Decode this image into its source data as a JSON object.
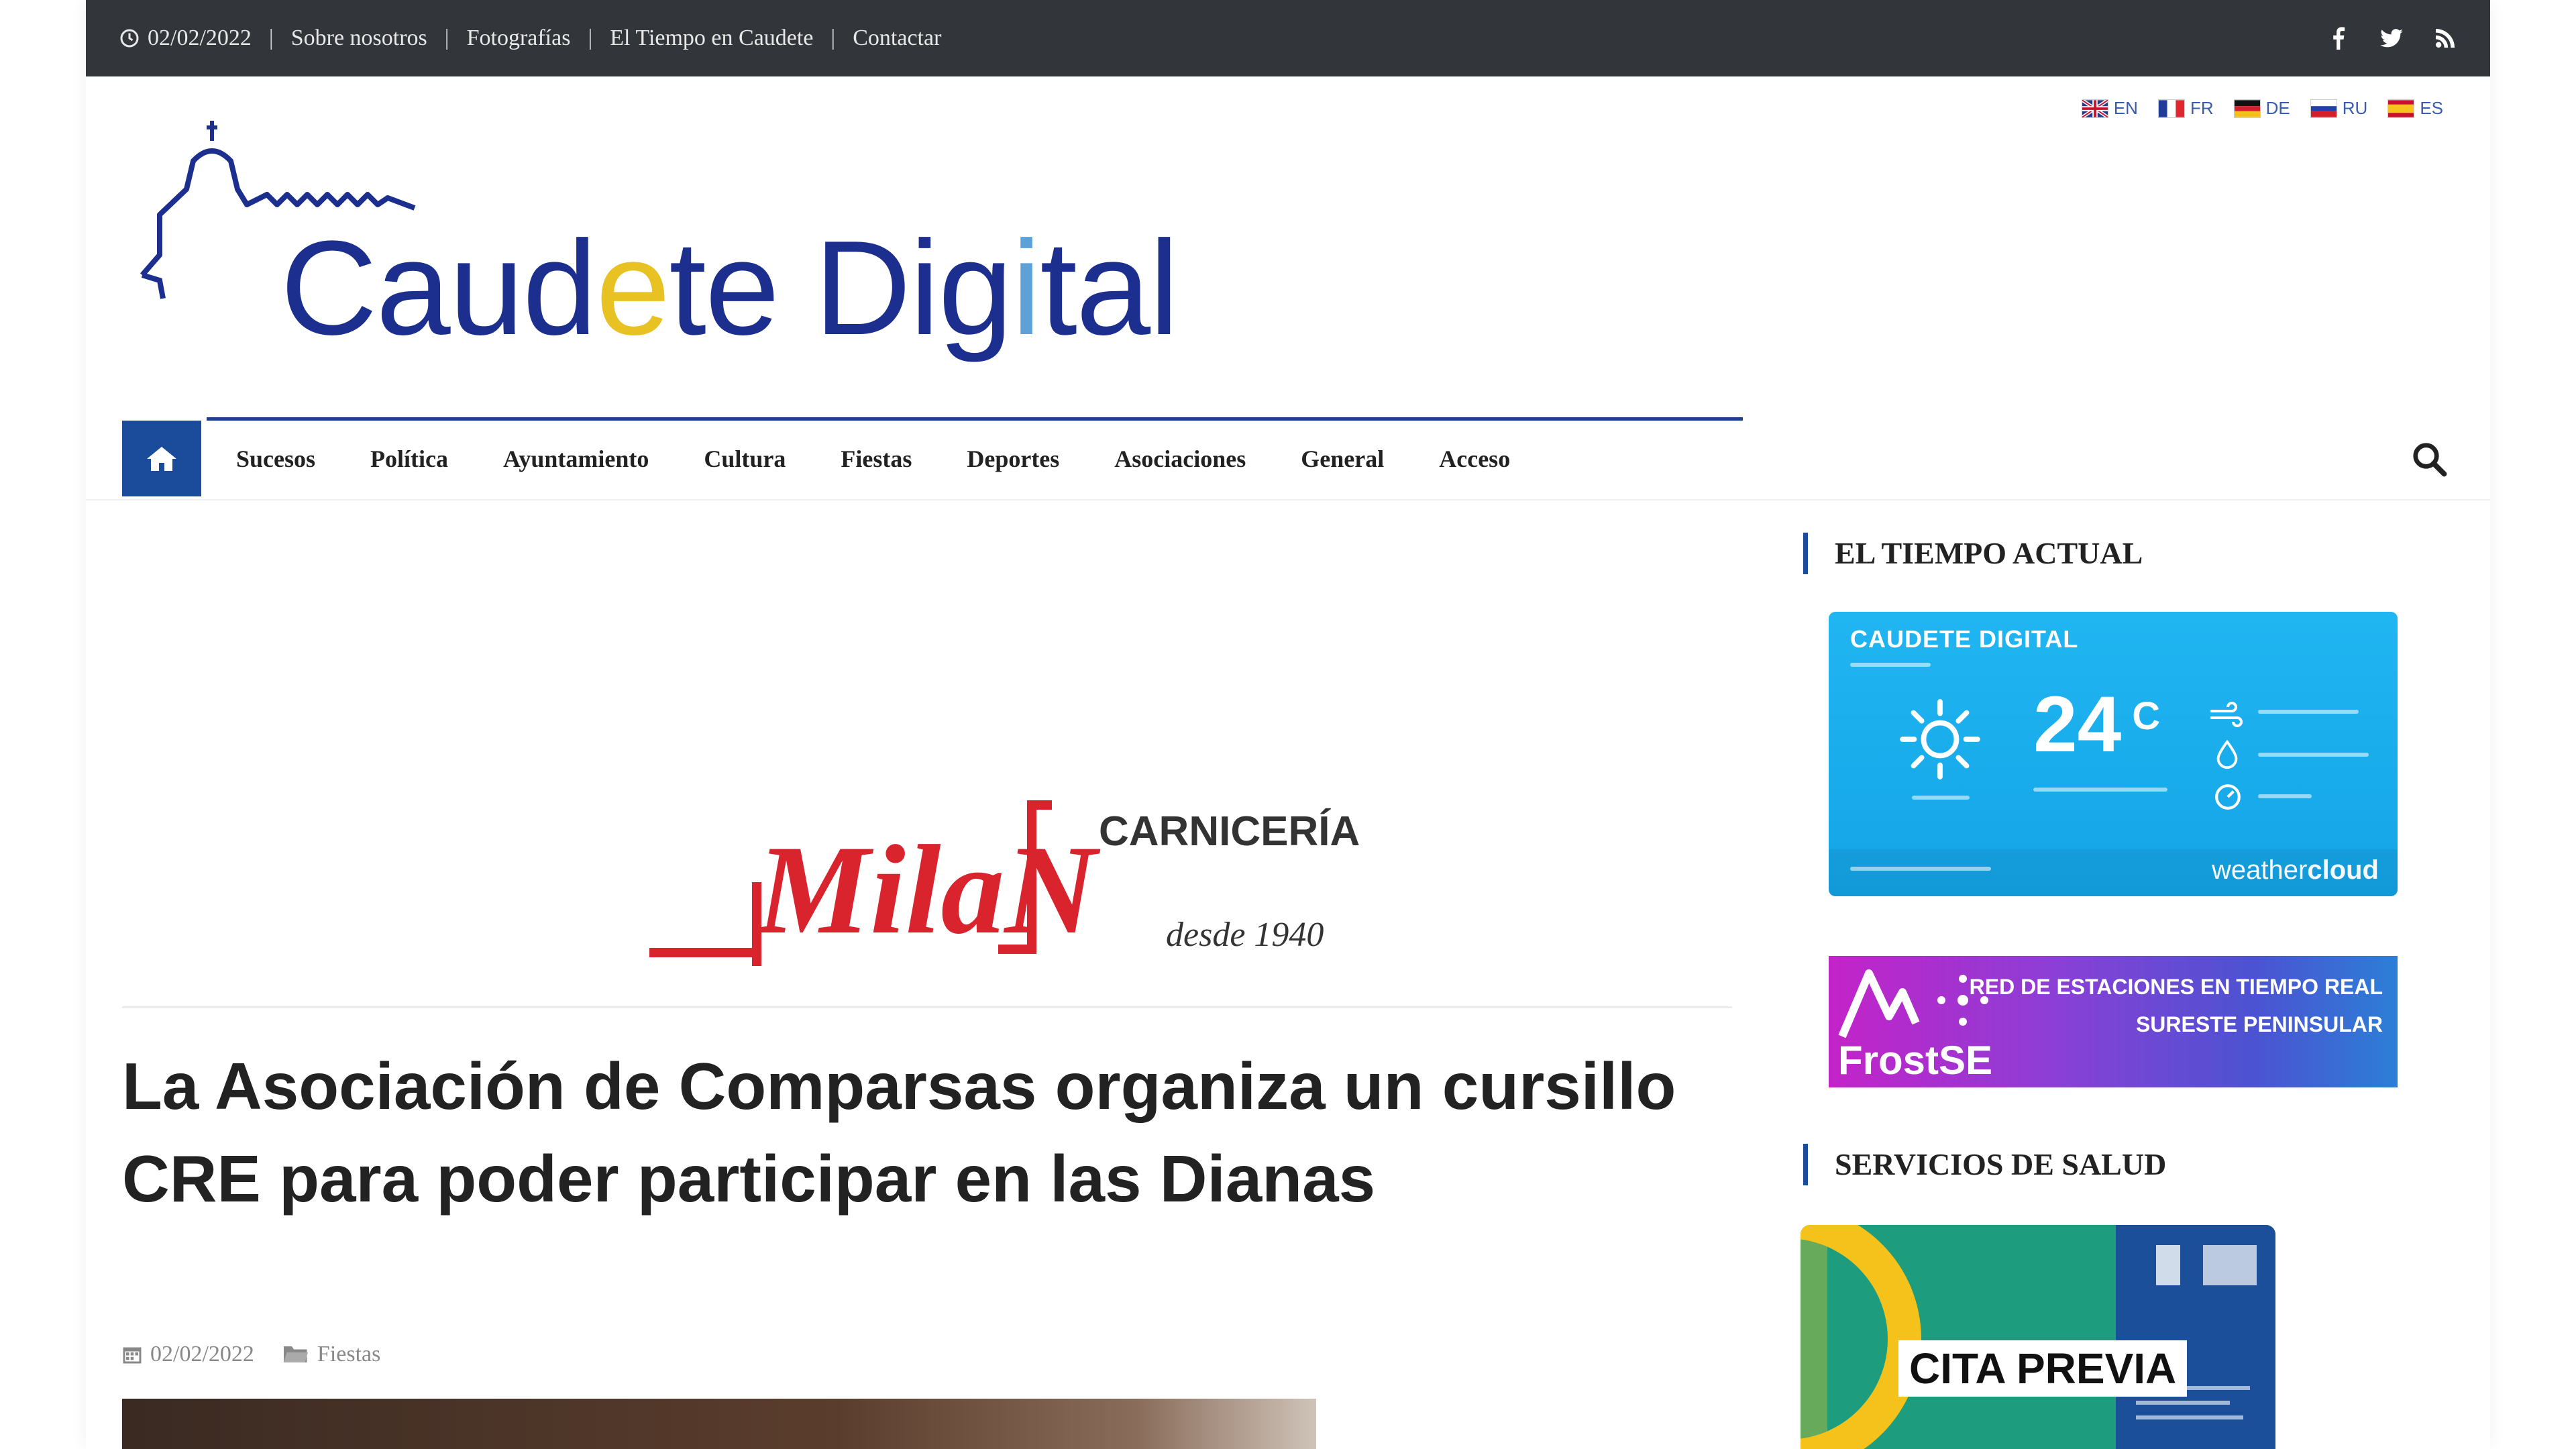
{
  "topbar": {
    "date": "02/02/2022",
    "links": [
      "Sobre nosotros",
      "Fotografías",
      "El Tiempo en Caudete",
      "Contactar"
    ],
    "social_icons": [
      "facebook-icon",
      "twitter-icon",
      "rss-icon"
    ]
  },
  "languages": [
    {
      "code": "EN",
      "icon": "flag-uk-icon"
    },
    {
      "code": "FR",
      "icon": "flag-france-icon"
    },
    {
      "code": "DE",
      "icon": "flag-germany-icon"
    },
    {
      "code": "RU",
      "icon": "flag-russia-icon"
    },
    {
      "code": "ES",
      "icon": "flag-spain-icon"
    }
  ],
  "logo": {
    "text": "Caudete Digital"
  },
  "nav": {
    "items": [
      "Sucesos",
      "Política",
      "Ayuntamiento",
      "Cultura",
      "Fiestas",
      "Deportes",
      "Asociaciones",
      "General",
      "Acceso"
    ],
    "accent": "#1b4b9b"
  },
  "ad": {
    "brand": "MilaN",
    "type": "CARNICERÍA",
    "since": "desde 1940",
    "color": "#d9232d"
  },
  "article": {
    "title": "La Asociación de Comparsas organiza un cursillo CRE para poder participar en las Dianas",
    "date": "02/02/2022",
    "category": "Fiestas"
  },
  "sidebar": {
    "weather_title": "EL TIEMPO ACTUAL",
    "weather_widget": {
      "station": "CAUDETE DIGITAL",
      "temperature": "24",
      "unit": "C",
      "brand_a": "weather",
      "brand_b": "cloud"
    },
    "frost": {
      "name": "FrostSE",
      "line1": "RED DE ESTACIONES EN TIEMPO REAL",
      "line2": "SURESTE PENINSULAR"
    },
    "health_title": "SERVICIOS DE SALUD",
    "cita": "CITA PREVIA"
  }
}
